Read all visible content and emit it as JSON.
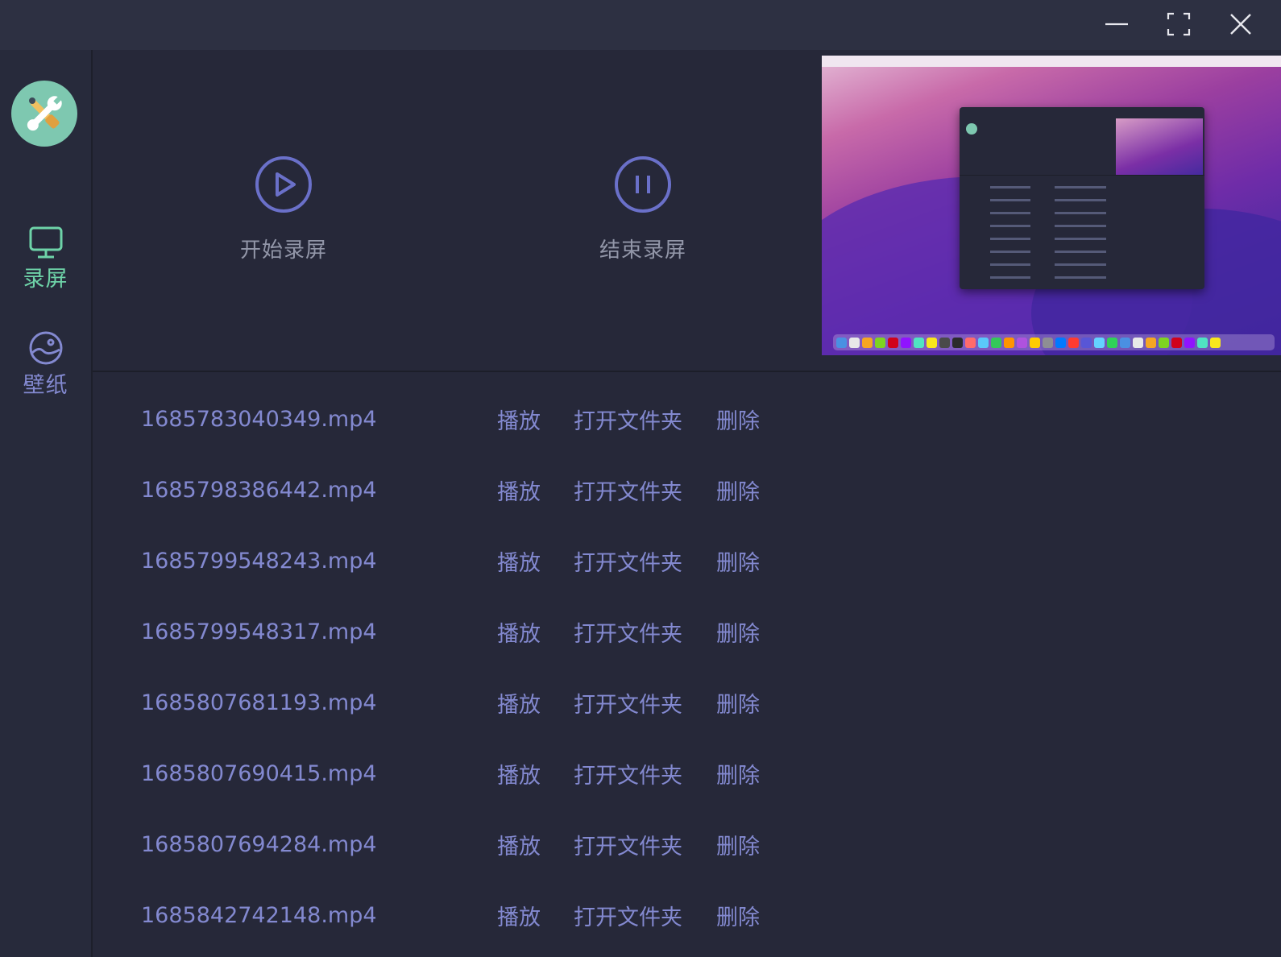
{
  "window": {
    "controls": [
      "minimize-icon",
      "fullscreen-icon",
      "close-icon"
    ]
  },
  "sidebar": {
    "logo_icon": "tools-icon",
    "items": [
      {
        "label": "录屏",
        "icon": "monitor-icon",
        "active": true,
        "color": "#6ed3a8"
      },
      {
        "label": "壁纸",
        "icon": "image-icon",
        "active": false,
        "color": "#8389d0"
      }
    ]
  },
  "actions": {
    "start": {
      "label": "开始录屏",
      "icon": "play-circle-icon"
    },
    "stop": {
      "label": "结束录屏",
      "icon": "pause-circle-icon"
    }
  },
  "files": [
    {
      "name": "1685783040349.mp4"
    },
    {
      "name": "1685798386442.mp4"
    },
    {
      "name": "1685799548243.mp4"
    },
    {
      "name": "1685799548317.mp4"
    },
    {
      "name": "1685807681193.mp4"
    },
    {
      "name": "1685807690415.mp4"
    },
    {
      "name": "1685807694284.mp4"
    },
    {
      "name": "1685842742148.mp4"
    }
  ],
  "row_actions": {
    "play": "播放",
    "open_folder": "打开文件夹",
    "delete": "删除"
  },
  "colors": {
    "accent": "#6ed3a8",
    "link": "#8389d0",
    "icon": "#6a70c9",
    "background": "#262839"
  }
}
